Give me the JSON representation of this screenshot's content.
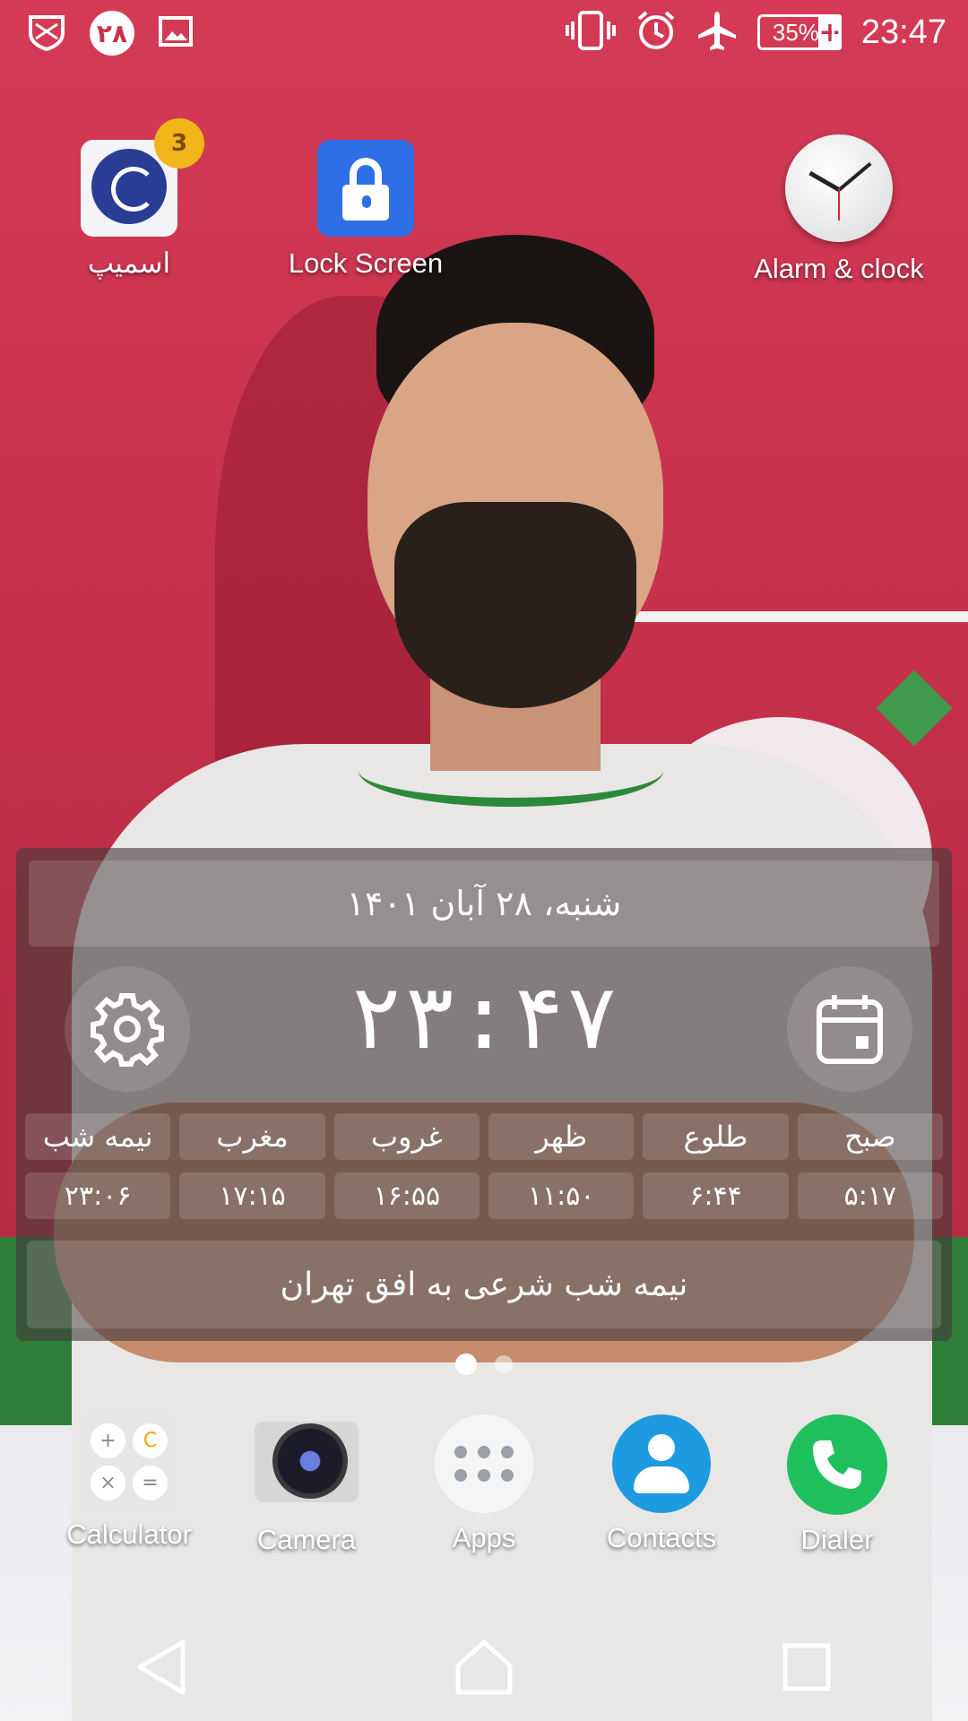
{
  "status_bar": {
    "date_badge": "۲۸",
    "battery_percent": "35%",
    "battery_charging_symbol": "+",
    "time": "23:47",
    "icons": [
      "shield-notification-icon",
      "calendar-date-badge",
      "image-notification-icon",
      "vibrate-icon",
      "alarm-icon",
      "airplane-mode-icon",
      "battery-icon"
    ]
  },
  "home_apps": [
    {
      "label": "اسمیپ",
      "badge": "3",
      "icon": "smeep-app-icon"
    },
    {
      "label": "Lock Screen",
      "icon": "lock-icon"
    },
    {
      "label": "Alarm & clock",
      "icon": "clock-icon"
    }
  ],
  "widget": {
    "date": "شنبه، ۲۸  آبان  ۱۴۰۱",
    "time": "۲۳:۴۷",
    "prayers": [
      {
        "name": "صبح",
        "time": "۵:۱۷"
      },
      {
        "name": "طلوع",
        "time": "۶:۴۴"
      },
      {
        "name": "ظهر",
        "time": "۱۱:۵۰"
      },
      {
        "name": "غروب",
        "time": "۱۶:۵۵"
      },
      {
        "name": "مغرب",
        "time": "۱۷:۱۵"
      },
      {
        "name": "نیمه شب",
        "time": "۲۳:۰۶"
      }
    ],
    "footer": "نیمه شب شرعی به افق تهران"
  },
  "page_indicator": {
    "pages": 2,
    "active": 1
  },
  "dock": [
    {
      "label": "Calculator",
      "icon": "calculator-icon"
    },
    {
      "label": "Camera",
      "icon": "camera-icon"
    },
    {
      "label": "Apps",
      "icon": "apps-grid-icon"
    },
    {
      "label": "Contacts",
      "icon": "contacts-icon"
    },
    {
      "label": "Dialer",
      "icon": "phone-icon"
    }
  ],
  "colors": {
    "wallpaper_red": "#c9314a",
    "widget_bg": "#463c3c",
    "dialer_green": "#1fc05c",
    "contacts_blue": "#1e9be0",
    "lock_blue": "#2f6fe6"
  }
}
